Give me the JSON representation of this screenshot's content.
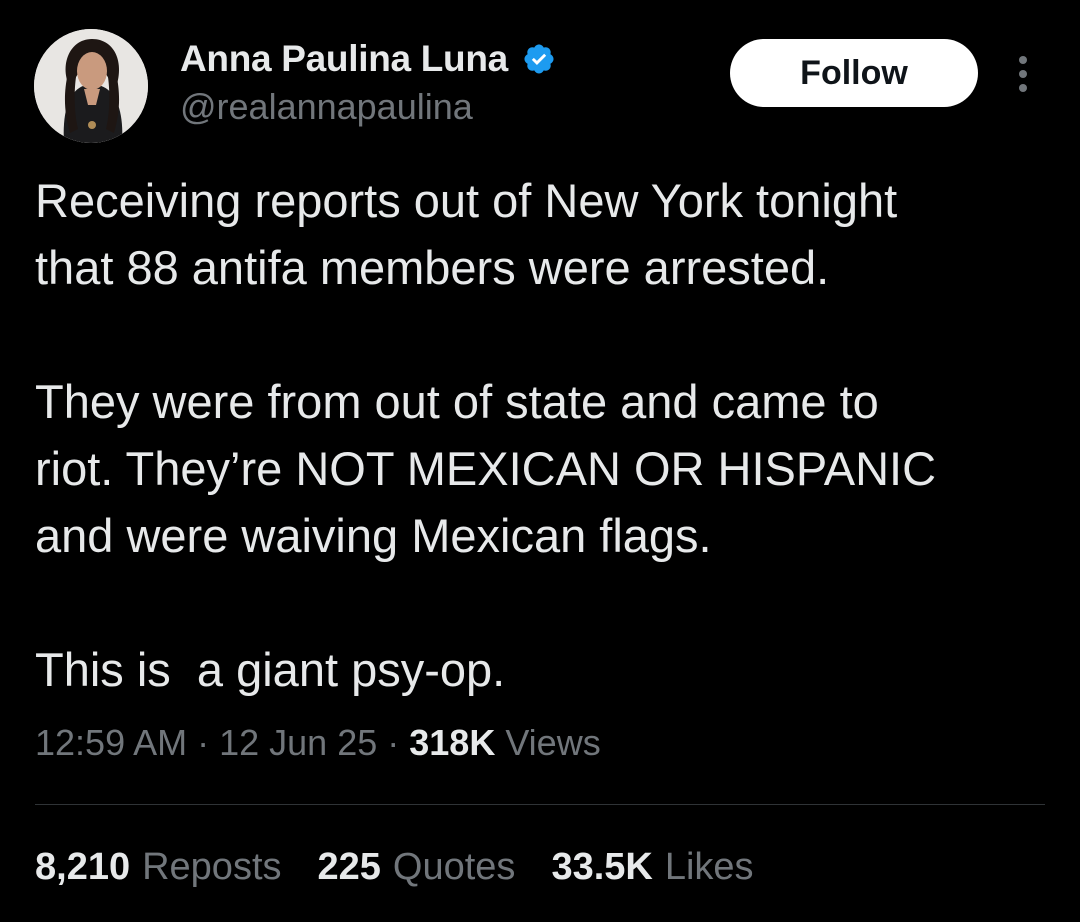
{
  "author": {
    "display_name": "Anna Paulina Luna",
    "handle": "@realannapaulina",
    "verified_icon": "verified-badge-icon",
    "verified_color": "#1d9bf0"
  },
  "actions": {
    "follow_label": "Follow",
    "more_icon": "more-vertical-icon"
  },
  "tweet": {
    "lines": [
      "Receiving reports out of New York tonight",
      "that 88 antifa members were arrested.",
      "",
      "They were from out of state and came to",
      "riot. They’re NOT MEXICAN OR HISPANIC",
      "and were waiving Mexican flags.",
      "",
      "This is  a giant psy-op."
    ]
  },
  "meta": {
    "time": "12:59 AM",
    "separator": "·",
    "date": "12 Jun 25",
    "views_count": "318K",
    "views_label": "Views"
  },
  "stats": {
    "reposts_count": "8,210",
    "reposts_label": "Reposts",
    "quotes_count": "225",
    "quotes_label": "Quotes",
    "likes_count": "33.5K",
    "likes_label": "Likes"
  },
  "colors": {
    "background": "#000000",
    "primary_text": "#e7e9ea",
    "secondary_text": "#71767b",
    "divider": "#2f3336",
    "follow_bg": "#ffffff",
    "follow_text": "#0f1419"
  }
}
